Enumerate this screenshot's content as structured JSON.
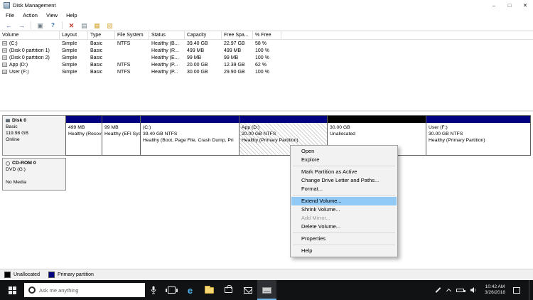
{
  "titlebar": {
    "title": "Disk Management"
  },
  "icons": {
    "minimize": "–",
    "maximize": "□",
    "close": "✕",
    "back": "←",
    "forward": "→",
    "window": "▣",
    "help": "?",
    "delete": "✕",
    "properties": "▤",
    "list_view": "▦",
    "graph_view": "▧",
    "edge": "e"
  },
  "menubar": {
    "items": [
      "File",
      "Action",
      "View",
      "Help"
    ]
  },
  "volume_table": {
    "columns": [
      "Volume",
      "Layout",
      "Type",
      "File System",
      "Status",
      "Capacity",
      "Free Spa...",
      "% Free"
    ],
    "rows": [
      [
        "(C:)",
        "Simple",
        "Basic",
        "NTFS",
        "Healthy (B...",
        "39.40 GB",
        "22.97 GB",
        "58 %"
      ],
      [
        "(Disk 0 partition 1)",
        "Simple",
        "Basic",
        "",
        "Healthy (R...",
        "499 MB",
        "499 MB",
        "100 %"
      ],
      [
        "(Disk 0 partition 2)",
        "Simple",
        "Basic",
        "",
        "Healthy (E...",
        "99 MB",
        "99 MB",
        "100 %"
      ],
      [
        "App (D:)",
        "Simple",
        "Basic",
        "NTFS",
        "Healthy (P...",
        "20.00 GB",
        "12.39 GB",
        "62 %"
      ],
      [
        "User (F:)",
        "Simple",
        "Basic",
        "NTFS",
        "Healthy (P...",
        "30.00 GB",
        "29.90 GB",
        "100 %"
      ]
    ]
  },
  "disk0": {
    "name": "Disk 0",
    "type": "Basic",
    "size": "119.98 GB",
    "status": "Online",
    "partitions": [
      {
        "line1": "499 MB",
        "line2": "Healthy (Recovery Parti",
        "line3": ""
      },
      {
        "line1": "99 MB",
        "line2": "Healthy (EFI Syst",
        "line3": ""
      },
      {
        "line1": "(C:)",
        "line2": "39.40 GB NTFS",
        "line3": "Healthy (Boot, Page File, Crash Dump, Pri"
      },
      {
        "line1": "App (D:)",
        "line2": "20.00 GB NTFS",
        "line3": "Healthy (Primary Partition)"
      },
      {
        "line1": "30.00 GB",
        "line2": "Unallocated",
        "line3": ""
      },
      {
        "line1": "User (F:)",
        "line2": "30.00 GB NTFS",
        "line3": "Healthy (Primary Partition)"
      }
    ]
  },
  "cdrom": {
    "name": "CD-ROM 0",
    "media": "DVD (G:)",
    "status": "No Media"
  },
  "legend": {
    "unallocated": "Unallocated",
    "primary": "Primary partition"
  },
  "context_menu": {
    "open": "Open",
    "explore": "Explore",
    "mark_active": "Mark Partition as Active",
    "change_letter": "Change Drive Letter and Paths...",
    "format": "Format...",
    "extend": "Extend Volume...",
    "shrink": "Shrink Volume...",
    "add_mirror": "Add Mirror...",
    "delete": "Delete Volume...",
    "properties": "Properties",
    "help": "Help"
  },
  "taskbar": {
    "search_placeholder": "Ask me anything",
    "clock": {
      "time": "10:42 AM",
      "date": "3/26/2018"
    }
  },
  "colors": {
    "primary_partition": "#000080",
    "unallocated": "#000000",
    "menu_highlight": "#91c9f7",
    "taskbar": "#111214",
    "active_app_underline": "#71b6e9"
  }
}
